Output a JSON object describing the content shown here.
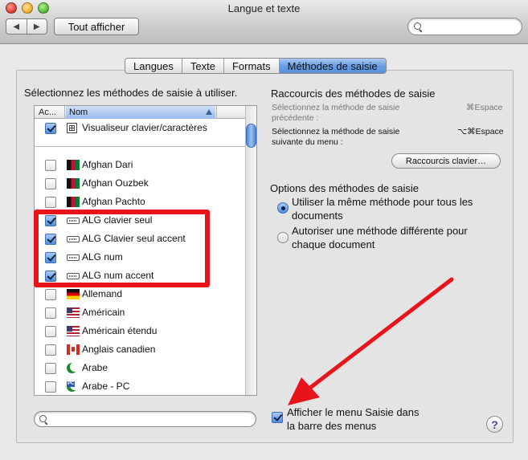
{
  "window": {
    "title": "Langue et texte"
  },
  "toolbar": {
    "back_glyph": "◀",
    "forward_glyph": "▶",
    "show_all_label": "Tout afficher",
    "search_placeholder": ""
  },
  "tabs": [
    {
      "label": "Langues",
      "selected": false
    },
    {
      "label": "Texte",
      "selected": false
    },
    {
      "label": "Formats",
      "selected": false
    },
    {
      "label": "Méthodes de saisie",
      "selected": true
    }
  ],
  "left": {
    "heading": "Sélectionnez les méthodes de saisie à utiliser.",
    "col_active": "Ac...",
    "col_name": "Nom",
    "pinned": {
      "label": "Visualiseur clavier/caractères",
      "checked": true,
      "icon": "keyboard-viewer-icon"
    },
    "rows": [
      {
        "label": "Afghan Dari",
        "checked": false,
        "icon": "flag-afghanistan-icon"
      },
      {
        "label": "Afghan Ouzbek",
        "checked": false,
        "icon": "flag-afghanistan-icon"
      },
      {
        "label": "Afghan Pachto",
        "checked": false,
        "icon": "flag-afghanistan-icon"
      },
      {
        "label": "ALG clavier seul",
        "checked": true,
        "icon": "keyboard-icon"
      },
      {
        "label": "ALG Clavier seul accent",
        "checked": true,
        "icon": "keyboard-icon"
      },
      {
        "label": "ALG num",
        "checked": true,
        "icon": "keyboard-icon"
      },
      {
        "label": "ALG num accent",
        "checked": true,
        "icon": "keyboard-icon"
      },
      {
        "label": "Allemand",
        "checked": false,
        "icon": "flag-germany-icon"
      },
      {
        "label": "Américain",
        "checked": false,
        "icon": "flag-usa-icon"
      },
      {
        "label": "Américain étendu",
        "checked": false,
        "icon": "flag-usa-icon"
      },
      {
        "label": "Anglais canadien",
        "checked": false,
        "icon": "flag-canada-icon"
      },
      {
        "label": "Arabe",
        "checked": false,
        "icon": "crescent-icon"
      },
      {
        "label": "Arabe - PC",
        "checked": false,
        "icon": "crescent-icon",
        "badge": "PC"
      }
    ],
    "search_placeholder": ""
  },
  "shortcuts": {
    "heading": "Raccourcis des méthodes de saisie",
    "prev_line1": "Sélectionnez la méthode de saisie",
    "prev_line2": "précédente :",
    "prev_key": "⌘Espace",
    "next_line1": "Sélectionnez la méthode de saisie",
    "next_line2": "suivante du menu :",
    "next_key": "⌥⌘Espace",
    "button": "Raccourcis clavier…"
  },
  "options": {
    "heading": "Options des méthodes de saisie",
    "opt1_line1": "Utiliser la même méthode pour tous les",
    "opt1_line2": "documents",
    "opt2_line1": "Autoriser une méthode différente pour",
    "opt2_line2": "chaque document",
    "selected": 1
  },
  "menu_option": {
    "line1": "Afficher le menu Saisie dans",
    "line2": "la barre des menus",
    "checked": true
  },
  "help": "?",
  "annotation_color": "#e8141c"
}
